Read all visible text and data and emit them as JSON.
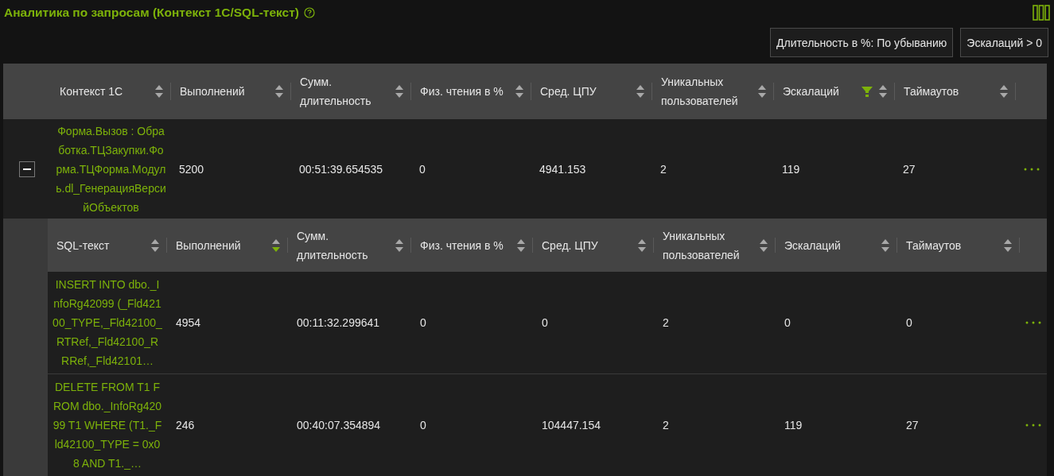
{
  "title": "Аналитика по запросам (Контекст 1С/SQL-текст)",
  "filters": [
    "Длительность в %: По убыванию",
    "Эскалаций > 0"
  ],
  "table": {
    "columns": [
      {
        "label": "Контекст 1С",
        "sort_asc": false,
        "sort_desc": false,
        "filtered": false
      },
      {
        "label": "Выполнений",
        "sort_asc": false,
        "sort_desc": false,
        "filtered": false
      },
      {
        "label": "Сумм. длительность",
        "sort_asc": false,
        "sort_desc": false,
        "filtered": false
      },
      {
        "label": "Физ. чтения в %",
        "sort_asc": false,
        "sort_desc": false,
        "filtered": false
      },
      {
        "label": "Сред. ЦПУ",
        "sort_asc": false,
        "sort_desc": false,
        "filtered": false
      },
      {
        "label": "Уникальных пользователей",
        "sort_asc": false,
        "sort_desc": false,
        "filtered": false
      },
      {
        "label": "Эскалаций",
        "sort_asc": false,
        "sort_desc": false,
        "filtered": true
      },
      {
        "label": "Таймаутов",
        "sort_asc": false,
        "sort_desc": false,
        "filtered": false
      }
    ],
    "rows": [
      {
        "expanded": true,
        "cells": [
          "Форма.Вызов : Обработка.ТЦЗакупки.Форма.ТЦФорма.Модуль.dl_ГенерацияВерсийОбъектов",
          "5200",
          "00:51:39.654535",
          "0",
          "4941.153",
          "2",
          "119",
          "27"
        ],
        "sub_table": {
          "columns": [
            {
              "label": "SQL-текст",
              "sort_asc": false,
              "sort_desc": false,
              "filtered": false
            },
            {
              "label": "Выполнений",
              "sort_asc": false,
              "sort_desc": true,
              "filtered": false
            },
            {
              "label": "Сумм. длительность",
              "sort_asc": false,
              "sort_desc": false,
              "filtered": false
            },
            {
              "label": "Физ. чтения в %",
              "sort_asc": false,
              "sort_desc": false,
              "filtered": false
            },
            {
              "label": "Сред. ЦПУ",
              "sort_asc": false,
              "sort_desc": false,
              "filtered": false
            },
            {
              "label": "Уникальных пользователей",
              "sort_asc": false,
              "sort_desc": false,
              "filtered": false
            },
            {
              "label": "Эскалаций",
              "sort_asc": false,
              "sort_desc": false,
              "filtered": false
            },
            {
              "label": "Таймаутов",
              "sort_asc": false,
              "sort_desc": false,
              "filtered": false
            }
          ],
          "rows": [
            {
              "cells": [
                "INSERT INTO dbo._InfoRg42099 (_Fld42100_TYPE,_Fld42100_RTRef,_Fld42100_RRRef,_Fld42101…",
                "4954",
                "00:11:32.299641",
                "0",
                "0",
                "2",
                "0",
                "0"
              ]
            },
            {
              "cells": [
                "DELETE FROM T1 FROM dbo._InfoRg42099 T1 WHERE (T1._Fld42100_TYPE = 0x08 AND T1._…",
                "246",
                "00:40:07.354894",
                "0",
                "104447.154",
                "2",
                "119",
                "27"
              ]
            }
          ]
        }
      }
    ]
  }
}
